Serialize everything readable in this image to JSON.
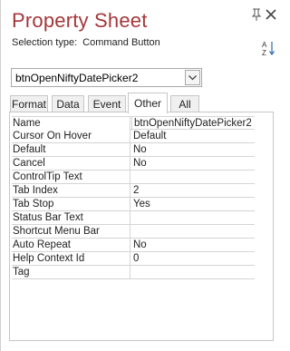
{
  "pane": {
    "title": "Property Sheet",
    "selection_type_label": "Selection type:",
    "selection_type_value": "Command Button"
  },
  "selector": {
    "value": "btnOpenNiftyDatePicker2"
  },
  "tabs": [
    {
      "label": "Format"
    },
    {
      "label": "Data"
    },
    {
      "label": "Event"
    },
    {
      "label": "Other",
      "active": true
    },
    {
      "label": "All"
    }
  ],
  "properties": [
    {
      "name": "Name",
      "value": "btnOpenNiftyDatePicker2"
    },
    {
      "name": "Cursor On Hover",
      "value": "Default"
    },
    {
      "name": "Default",
      "value": "No"
    },
    {
      "name": "Cancel",
      "value": "No"
    },
    {
      "name": "ControlTip Text",
      "value": ""
    },
    {
      "name": "Tab Index",
      "value": "2"
    },
    {
      "name": "Tab Stop",
      "value": "Yes"
    },
    {
      "name": "Status Bar Text",
      "value": ""
    },
    {
      "name": "Shortcut Menu Bar",
      "value": ""
    },
    {
      "name": "Auto Repeat",
      "value": "No"
    },
    {
      "name": "Help Context Id",
      "value": "0"
    },
    {
      "name": "Tag",
      "value": ""
    }
  ],
  "colors": {
    "title": "#a4373a",
    "border": "#c6c6c6"
  },
  "icons": {
    "pin": "pin-icon",
    "close": "close-icon",
    "sort": "sort-az-icon",
    "dropdown": "chevron-down-icon"
  }
}
